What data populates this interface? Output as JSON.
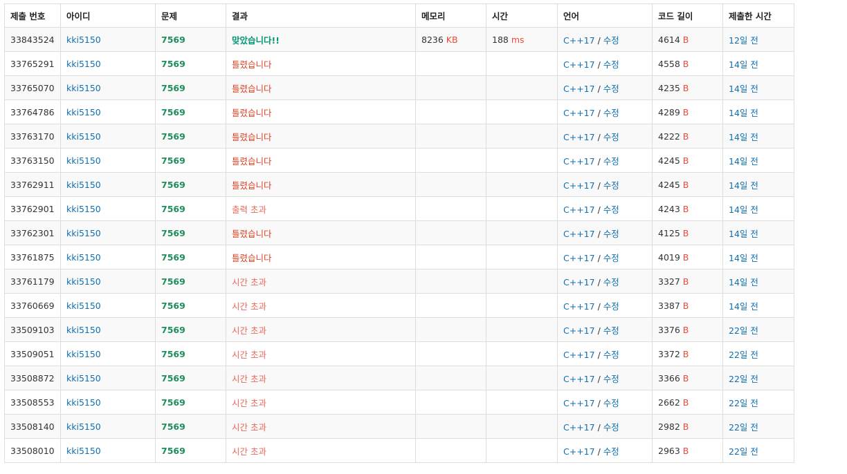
{
  "columns": [
    "제출 번호",
    "아이디",
    "문제",
    "결과",
    "메모리",
    "시간",
    "언어",
    "코드 길이",
    "제출한 시간"
  ],
  "units": {
    "memory": "KB",
    "time": "ms",
    "code": "B"
  },
  "language_edit_label": "수정",
  "result_colors": {
    "ac": "#009874",
    "wa": "#dd4124",
    "tle": "#e8685a"
  },
  "rows": [
    {
      "id": "33843524",
      "user": "kki5150",
      "problem": "7569",
      "result": "맞았습니다!!",
      "result_type": "ac",
      "memory": "8236",
      "time": "188",
      "lang": "C++17",
      "code_len": "4614",
      "submitted": "12일 전"
    },
    {
      "id": "33765291",
      "user": "kki5150",
      "problem": "7569",
      "result": "틀렸습니다",
      "result_type": "wa",
      "memory": "",
      "time": "",
      "lang": "C++17",
      "code_len": "4558",
      "submitted": "14일 전"
    },
    {
      "id": "33765070",
      "user": "kki5150",
      "problem": "7569",
      "result": "틀렸습니다",
      "result_type": "wa",
      "memory": "",
      "time": "",
      "lang": "C++17",
      "code_len": "4235",
      "submitted": "14일 전"
    },
    {
      "id": "33764786",
      "user": "kki5150",
      "problem": "7569",
      "result": "틀렸습니다",
      "result_type": "wa",
      "memory": "",
      "time": "",
      "lang": "C++17",
      "code_len": "4289",
      "submitted": "14일 전"
    },
    {
      "id": "33763170",
      "user": "kki5150",
      "problem": "7569",
      "result": "틀렸습니다",
      "result_type": "wa",
      "memory": "",
      "time": "",
      "lang": "C++17",
      "code_len": "4222",
      "submitted": "14일 전"
    },
    {
      "id": "33763150",
      "user": "kki5150",
      "problem": "7569",
      "result": "틀렸습니다",
      "result_type": "wa",
      "memory": "",
      "time": "",
      "lang": "C++17",
      "code_len": "4245",
      "submitted": "14일 전"
    },
    {
      "id": "33762911",
      "user": "kki5150",
      "problem": "7569",
      "result": "틀렸습니다",
      "result_type": "wa",
      "memory": "",
      "time": "",
      "lang": "C++17",
      "code_len": "4245",
      "submitted": "14일 전"
    },
    {
      "id": "33762901",
      "user": "kki5150",
      "problem": "7569",
      "result": "출력 초과",
      "result_type": "tle",
      "memory": "",
      "time": "",
      "lang": "C++17",
      "code_len": "4243",
      "submitted": "14일 전"
    },
    {
      "id": "33762301",
      "user": "kki5150",
      "problem": "7569",
      "result": "틀렸습니다",
      "result_type": "wa",
      "memory": "",
      "time": "",
      "lang": "C++17",
      "code_len": "4125",
      "submitted": "14일 전"
    },
    {
      "id": "33761875",
      "user": "kki5150",
      "problem": "7569",
      "result": "틀렸습니다",
      "result_type": "wa",
      "memory": "",
      "time": "",
      "lang": "C++17",
      "code_len": "4019",
      "submitted": "14일 전"
    },
    {
      "id": "33761179",
      "user": "kki5150",
      "problem": "7569",
      "result": "시간 초과",
      "result_type": "tle",
      "memory": "",
      "time": "",
      "lang": "C++17",
      "code_len": "3327",
      "submitted": "14일 전"
    },
    {
      "id": "33760669",
      "user": "kki5150",
      "problem": "7569",
      "result": "시간 초과",
      "result_type": "tle",
      "memory": "",
      "time": "",
      "lang": "C++17",
      "code_len": "3387",
      "submitted": "14일 전"
    },
    {
      "id": "33509103",
      "user": "kki5150",
      "problem": "7569",
      "result": "시간 초과",
      "result_type": "tle",
      "memory": "",
      "time": "",
      "lang": "C++17",
      "code_len": "3376",
      "submitted": "22일 전"
    },
    {
      "id": "33509051",
      "user": "kki5150",
      "problem": "7569",
      "result": "시간 초과",
      "result_type": "tle",
      "memory": "",
      "time": "",
      "lang": "C++17",
      "code_len": "3372",
      "submitted": "22일 전"
    },
    {
      "id": "33508872",
      "user": "kki5150",
      "problem": "7569",
      "result": "시간 초과",
      "result_type": "tle",
      "memory": "",
      "time": "",
      "lang": "C++17",
      "code_len": "3366",
      "submitted": "22일 전"
    },
    {
      "id": "33508553",
      "user": "kki5150",
      "problem": "7569",
      "result": "시간 초과",
      "result_type": "tle",
      "memory": "",
      "time": "",
      "lang": "C++17",
      "code_len": "2662",
      "submitted": "22일 전"
    },
    {
      "id": "33508140",
      "user": "kki5150",
      "problem": "7569",
      "result": "시간 초과",
      "result_type": "tle",
      "memory": "",
      "time": "",
      "lang": "C++17",
      "code_len": "2982",
      "submitted": "22일 전"
    },
    {
      "id": "33508010",
      "user": "kki5150",
      "problem": "7569",
      "result": "시간 초과",
      "result_type": "tle",
      "memory": "",
      "time": "",
      "lang": "C++17",
      "code_len": "2963",
      "submitted": "22일 전"
    }
  ]
}
